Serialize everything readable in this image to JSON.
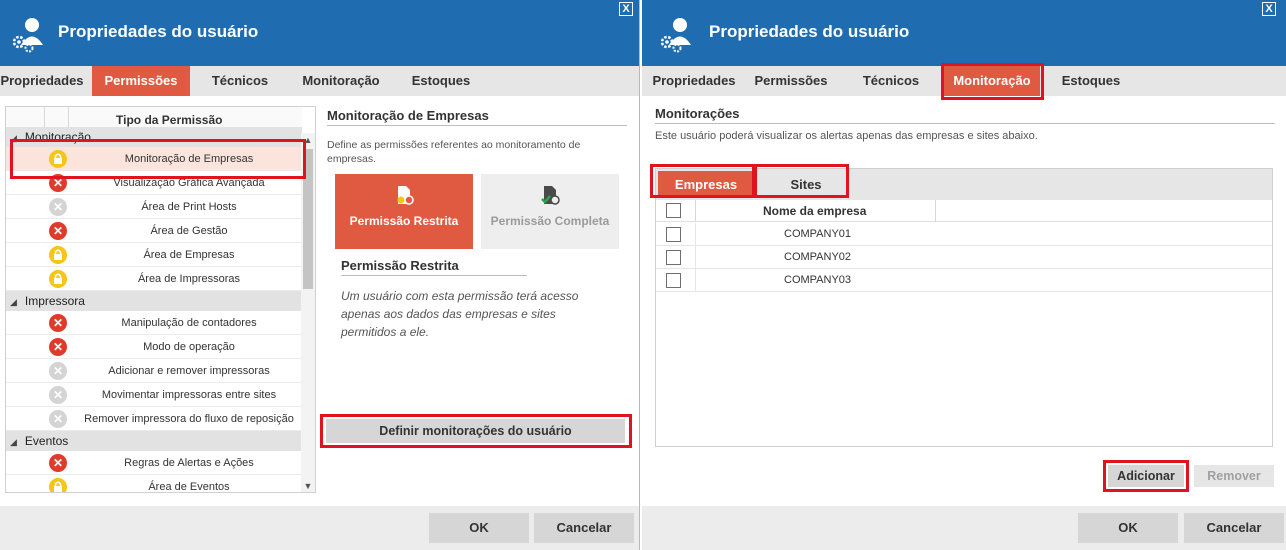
{
  "colors": {
    "titlebar": "#1f6cb0",
    "accent": "#e05a42",
    "highlight_box": "#e0141e"
  },
  "left": {
    "title": "Propriedades do usuário",
    "close_label": "X",
    "tabs": [
      {
        "label": "Propriedades",
        "active": false
      },
      {
        "label": "Permissões",
        "active": true
      },
      {
        "label": "Técnicos",
        "active": false
      },
      {
        "label": "Monitoração",
        "active": false
      },
      {
        "label": "Estoques",
        "active": false
      }
    ],
    "tree": {
      "header": "Tipo da Permissão",
      "groups": [
        {
          "name": "Monitoração",
          "items": [
            {
              "label": "Monitoração de Empresas",
              "status": "lock-icon",
              "selected": true
            },
            {
              "label": "Visualização Gráfica Avançada",
              "status": "denied-icon"
            },
            {
              "label": "Área de Print Hosts",
              "status": "disabled-icon"
            },
            {
              "label": "Área de Gestão",
              "status": "denied-icon"
            },
            {
              "label": "Área de Empresas",
              "status": "lock-icon"
            },
            {
              "label": "Área de Impressoras",
              "status": "lock-icon"
            }
          ]
        },
        {
          "name": "Impressora",
          "items": [
            {
              "label": "Manipulação de contadores",
              "status": "denied-icon"
            },
            {
              "label": "Modo de operação",
              "status": "denied-icon"
            },
            {
              "label": "Adicionar e remover impressoras",
              "status": "disabled-icon"
            },
            {
              "label": "Movimentar impressoras entre sites",
              "status": "disabled-icon"
            },
            {
              "label": "Remover impressora do fluxo de reposição",
              "status": "disabled-icon"
            }
          ]
        },
        {
          "name": "Eventos",
          "items": [
            {
              "label": "Regras de Alertas e Ações",
              "status": "denied-icon"
            },
            {
              "label": "Área de Eventos",
              "status": "lock-icon"
            }
          ]
        }
      ]
    },
    "detail": {
      "title": "Monitoração de Empresas",
      "description": "Define as permissões referentes ao monitoramento de empresas.",
      "card_restricted": "Permissão Restrita",
      "card_full": "Permissão Completa",
      "sub_title": "Permissão Restrita",
      "sub_description": "Um usuário com esta permissão terá acesso apenas aos dados das empresas e sites permitidos a ele.",
      "define_button": "Definir monitorações do usuário"
    },
    "ok": "OK",
    "cancel": "Cancelar"
  },
  "right": {
    "title": "Propriedades do usuário",
    "close_label": "X",
    "tabs": [
      {
        "label": "Propriedades",
        "active": false
      },
      {
        "label": "Permissões",
        "active": false
      },
      {
        "label": "Técnicos",
        "active": false
      },
      {
        "label": "Monitoração",
        "active": true
      },
      {
        "label": "Estoques",
        "active": false
      }
    ],
    "section_title": "Monitorações",
    "section_desc": "Este usuário poderá visualizar os alertas apenas das empresas e sites abaixo.",
    "grid": {
      "tabs": [
        {
          "label": "Empresas",
          "active": true
        },
        {
          "label": "Sites",
          "active": false
        }
      ],
      "column": "Nome da empresa",
      "rows": [
        {
          "name": "COMPANY01"
        },
        {
          "name": "COMPANY02"
        },
        {
          "name": "COMPANY03"
        }
      ]
    },
    "add": "Adicionar",
    "remove": "Remover",
    "ok": "OK",
    "cancel": "Cancelar"
  }
}
